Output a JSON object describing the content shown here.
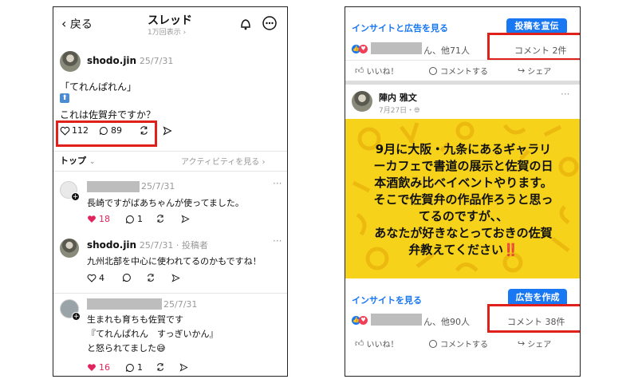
{
  "threads": {
    "back_label": "戻る",
    "title": "スレッド",
    "views": "1万回表示",
    "post": {
      "username": "shodo.jin",
      "date": "25/7/31",
      "line1": "「てれんぱれん」",
      "line2": "これは佐賀弁ですか？",
      "likes": "112",
      "comments": "89"
    },
    "top_label": "トップ",
    "activity_label": "アクティビティを見る",
    "replies": [
      {
        "date": "25/7/31",
        "text": "長崎ですがばあちゃんが使ってました。",
        "likes": "18",
        "comments": "1"
      },
      {
        "username": "shodo.jin",
        "date": "25/7/31",
        "role": "投稿者",
        "text": "九州北部を中心に使われてるのかもですね！",
        "likes": "4"
      },
      {
        "date": "25/7/31",
        "line1": "生まれも育ちも佐賀です",
        "line2": "『てれんぱれん　すっぎいかん』",
        "line3": "と怒られてました😅",
        "likes": "16",
        "comments": "1"
      }
    ]
  },
  "facebook": {
    "insights_ads_label": "インサイトと広告を見る",
    "promote_button": "投稿を宣伝",
    "reactions_top": "ん、他71人",
    "comments_top": "コメント 2件",
    "like_label": "いいね！",
    "comment_label": "コメントする",
    "share_label": "シェア",
    "author": "陣内 雅文",
    "post_date": "7月27日・",
    "banner_lines": [
      "9月に大阪・九条にあるギャラリ",
      "ーカフェで書道の展示と佐賀の日",
      "本酒飲み比べイベントやります。",
      "そこで佐賀弁の作品作ろうと思っ",
      "てるのですが、、",
      "あなたが好きなとっておきの佐賀",
      "弁教えてください"
    ],
    "exclaim": "‼️",
    "insights_label": "インサイトを見る",
    "create_ad_button": "広告を作成",
    "reactions_bottom": "ん、他90人",
    "comments_bottom": "コメント 38件",
    "like_label_2": "いいね！",
    "comment_label_2": "コメントする",
    "share_label_2": "シェア"
  },
  "colors": {
    "highlight": "#e0201b",
    "fb_blue": "#1877f2",
    "banner": "#f7d21b",
    "heart_red": "#e0245e"
  }
}
